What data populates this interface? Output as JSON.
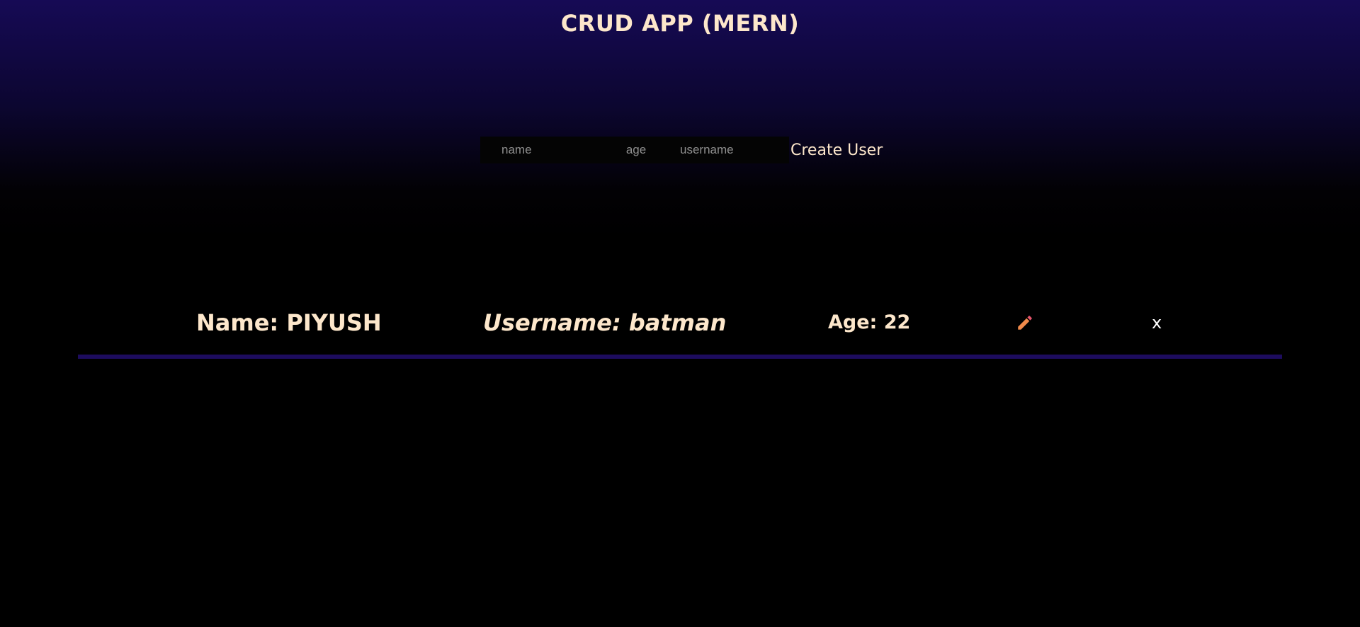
{
  "app": {
    "title": "CRUD APP (MERN)"
  },
  "form": {
    "name_placeholder": "name",
    "age_placeholder": "age",
    "username_placeholder": "username",
    "name_value": "",
    "age_value": "",
    "username_value": "",
    "submit_label": "Create User"
  },
  "users": [
    {
      "name_text": "Name: PIYUSH",
      "username_text": "Username: batman",
      "age_text": "Age: 22",
      "edit_icon": "pencil-icon",
      "delete_label": "x"
    }
  ],
  "colors": {
    "background_top": "#160a55",
    "background_bottom": "#000000",
    "text": "#fde7cb",
    "divider": "#1d0c5e",
    "pencil_body": "#f08a4b",
    "pencil_tip": "#e8556d"
  }
}
